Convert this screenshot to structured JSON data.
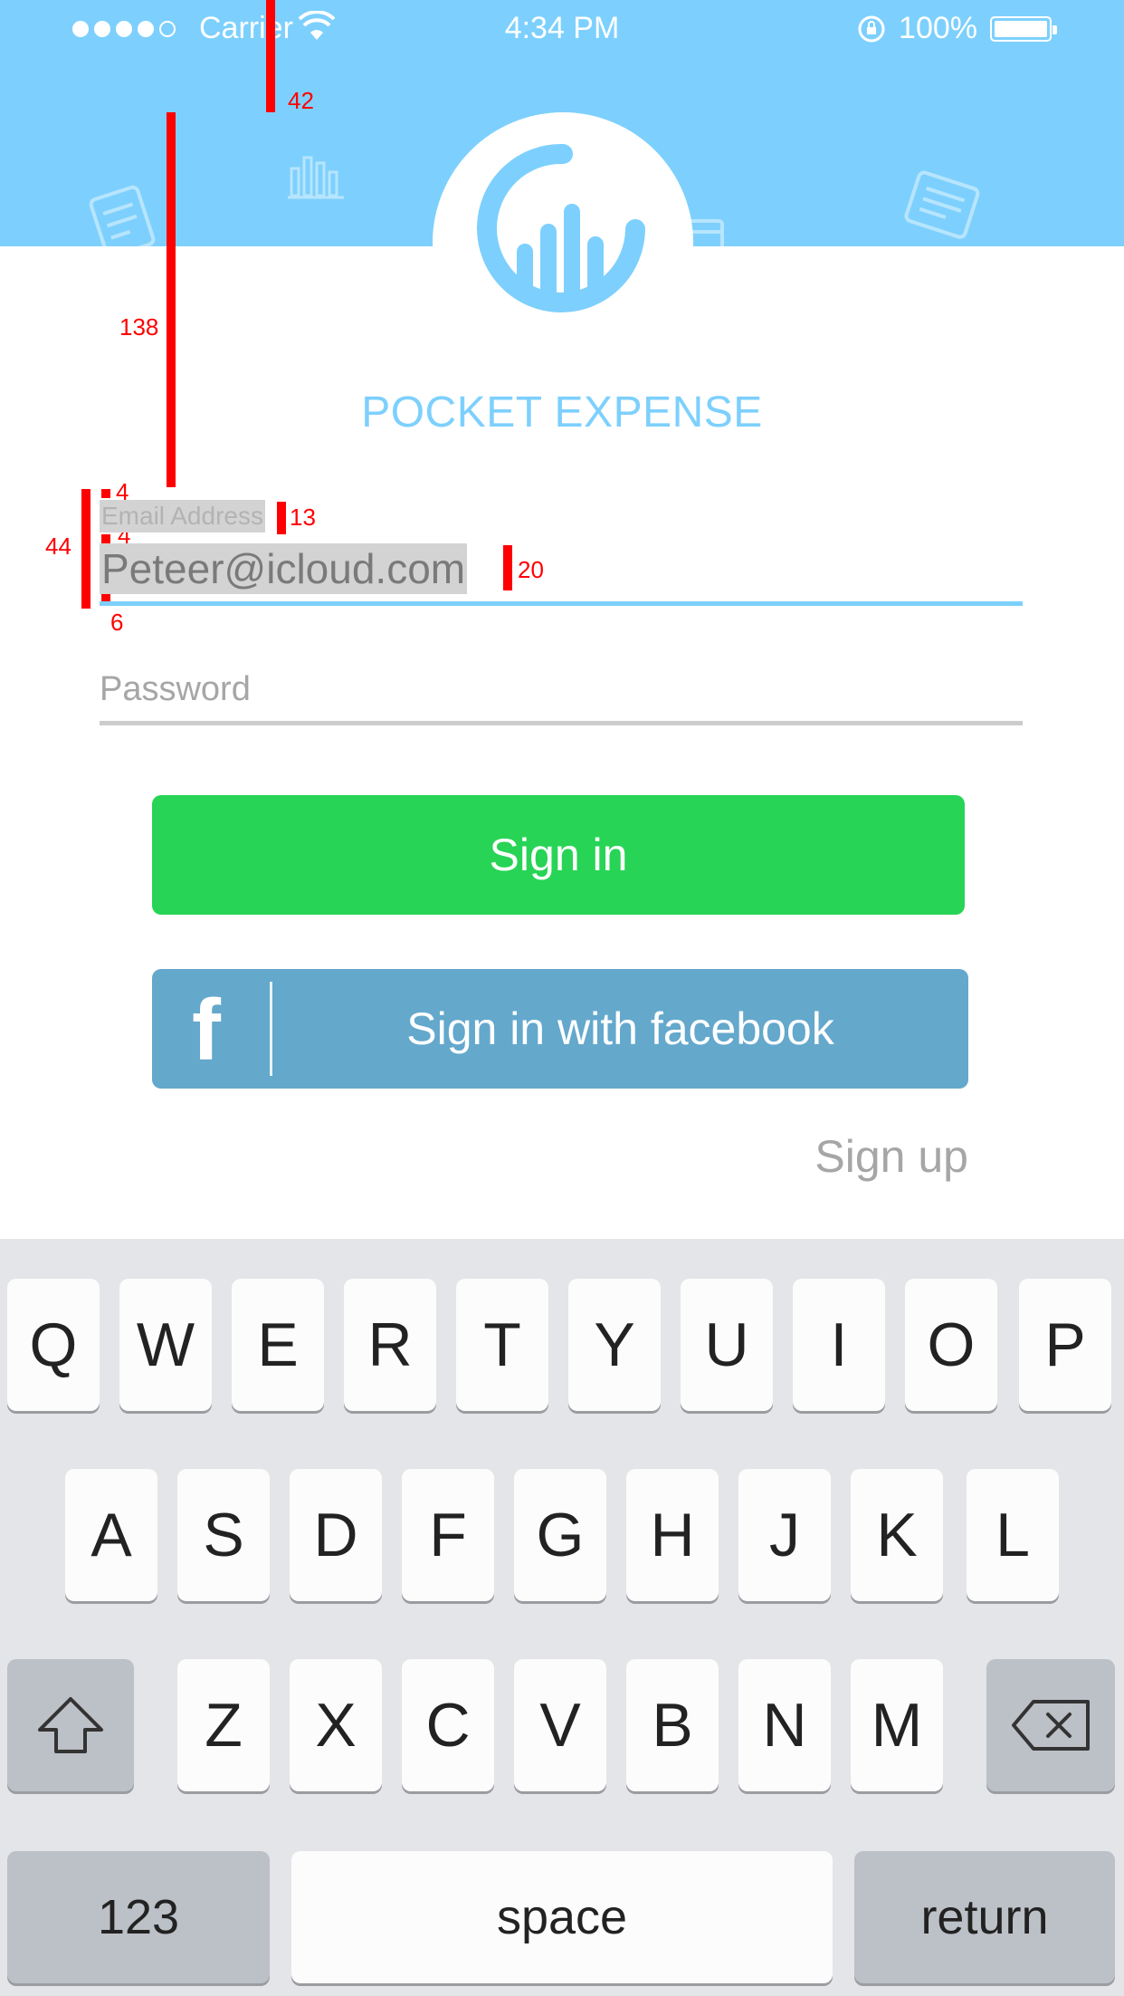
{
  "status_bar": {
    "carrier": "Carrier",
    "time": "4:34 PM",
    "battery": "100%"
  },
  "app": {
    "brand": "POCKET EXPENSE",
    "accent_color": "#7dd0fd"
  },
  "form": {
    "email_label": "Email Address",
    "email_value": "Peteer@icloud.com",
    "password_placeholder": "Password",
    "signin_label": "Sign in",
    "facebook_label": "Sign in with facebook",
    "facebook_glyph": "f",
    "signup_label": "Sign up"
  },
  "annotations": {
    "top_gap": "42",
    "logo_gap": "138",
    "label_top": "4",
    "label_size": "13",
    "label_gap": "4",
    "field_height": "44",
    "value_size": "20",
    "underline_gap": "6"
  },
  "keyboard": {
    "row1": [
      "Q",
      "W",
      "E",
      "R",
      "T",
      "Y",
      "U",
      "I",
      "O",
      "P"
    ],
    "row2": [
      "A",
      "S",
      "D",
      "F",
      "G",
      "H",
      "J",
      "K",
      "L"
    ],
    "row3": [
      "Z",
      "X",
      "C",
      "V",
      "B",
      "N",
      "M"
    ],
    "numbers_label": "123",
    "space_label": "space",
    "return_label": "return"
  }
}
